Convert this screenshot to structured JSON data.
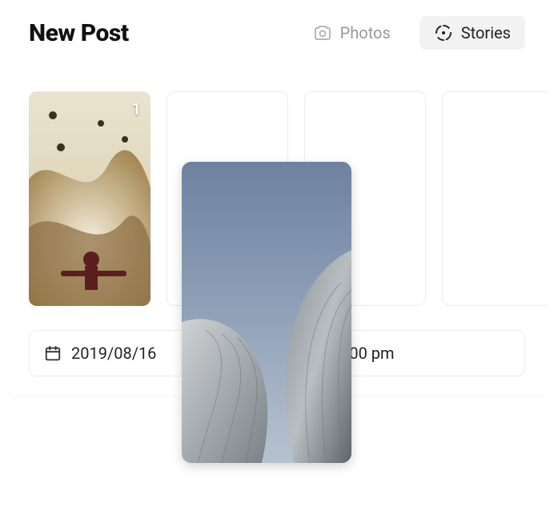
{
  "header": {
    "title": "New Post",
    "tabs": {
      "photos_label": "Photos",
      "stories_label": "Stories",
      "active": "stories"
    }
  },
  "slots": [
    {
      "filled": true,
      "badge": "1",
      "image": "ocean-splash"
    },
    {
      "filled": false
    },
    {
      "filled": false
    },
    {
      "filled": false
    }
  ],
  "date_picker": {
    "value": "2019/08/16"
  },
  "time_picker": {
    "value": "02:00 pm"
  },
  "floating_preview": {
    "image": "building-curves"
  },
  "icons": {
    "camera": "camera-icon",
    "stories": "stories-icon",
    "calendar": "calendar-icon",
    "clock": "clock-icon"
  }
}
